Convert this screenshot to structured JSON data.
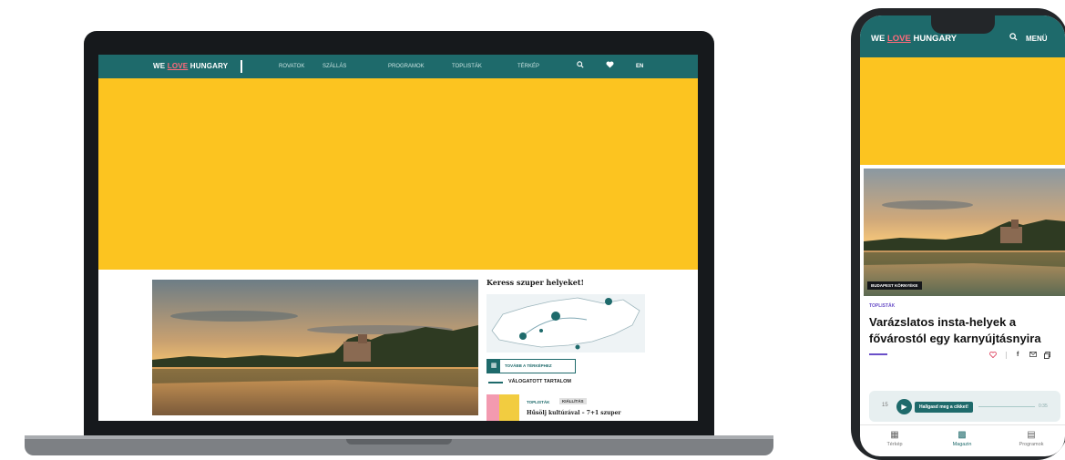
{
  "colors": {
    "brand_teal": "#1e6a6b",
    "banner_yellow": "#fcc420",
    "love_pink": "#ff6b7b",
    "purple_accent": "#6a4fc8"
  },
  "desktop": {
    "logo": {
      "we": "WE",
      "love": "LOVE",
      "hungary": "HUNGARY"
    },
    "nav": [
      "ROVATOK",
      "SZÁLLÁS",
      "PROGRAMOK",
      "TOPLISTÁK",
      "TÉRKÉP"
    ],
    "nav_icons": {
      "search": "search-icon",
      "favorites": "heart-icon"
    },
    "lang": "EN",
    "sidebar": {
      "title": "Keress szuper helyeket!",
      "map_button": "TOVÁBB A TÉRKÉPHEZ",
      "curated": "VÁLOGATOTT TARTALOM",
      "article": {
        "tag1": "TOPLISTÁK",
        "tag2": "KIÁLLÍTÁS",
        "title": "Hűsölj kultúrával – 7+1 szuper"
      }
    }
  },
  "mobile": {
    "logo": {
      "we": "WE",
      "love": "LOVE",
      "hungary": "HUNGARY"
    },
    "menu": "MENÜ",
    "category": "BUDAPEST KÖRNYÉKE",
    "tag": "TOPLISTÁK",
    "title_line1": "Varázslatos insta-helyek a",
    "title_line2": "fővárostól egy karnyújtásnyira",
    "audio": {
      "skip": "15",
      "cta": "Hallgasd meg a cikket!",
      "time": "0:35"
    },
    "tabs": [
      {
        "label": "Térkép"
      },
      {
        "label": "Magazin"
      },
      {
        "label": "Programok"
      }
    ]
  }
}
